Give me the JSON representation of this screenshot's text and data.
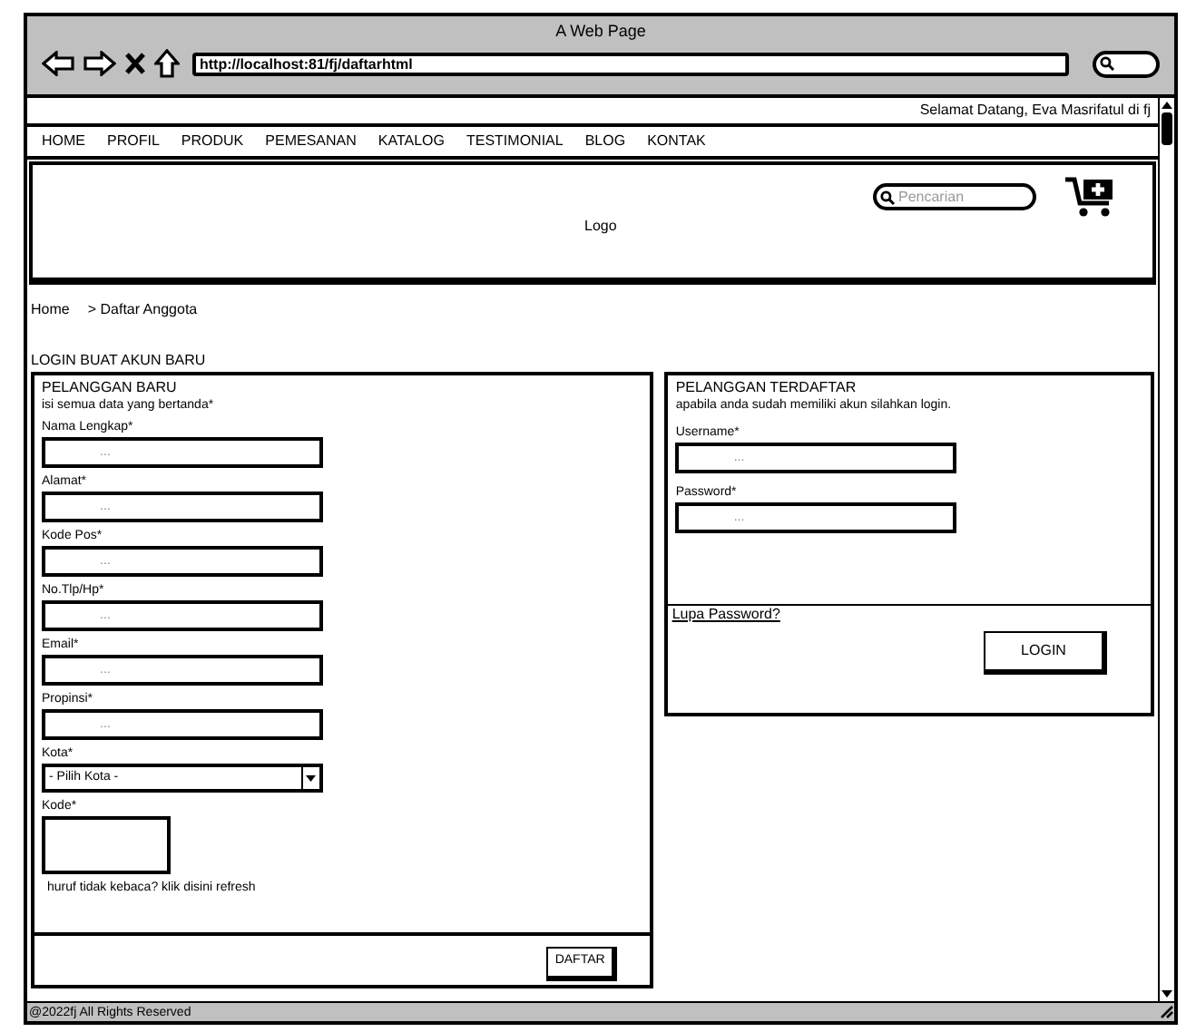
{
  "window": {
    "title": "A Web Page",
    "url": "http://localhost:81/fj/daftarhtml"
  },
  "welcome": "Selamat Datang, Eva Masrifatul di fj",
  "menu": [
    {
      "label": "HOME"
    },
    {
      "label": "PROFIL"
    },
    {
      "label": "PRODUK"
    },
    {
      "label": "PEMESANAN"
    },
    {
      "label": "KATALOG"
    },
    {
      "label": "TESTIMONIAL"
    },
    {
      "label": "BLOG"
    },
    {
      "label": "KONTAK"
    }
  ],
  "header": {
    "logo": "Logo",
    "search": {
      "placeholder": "Pencarian"
    }
  },
  "breadcrumb": [
    "Home",
    "> Daftar Anggota"
  ],
  "section_title": "LOGIN BUAT AKUN BARU",
  "new_customer": {
    "title": "PELANGGAN BARU",
    "subtitle": "isi semua data yang bertanda*",
    "fields": [
      {
        "kind": "text",
        "label": "Nama Lengkap*",
        "placeholder": "..."
      },
      {
        "kind": "text",
        "label": "Alamat*",
        "placeholder": "..."
      },
      {
        "kind": "text",
        "label": "Kode Pos*",
        "placeholder": "..."
      },
      {
        "kind": "text",
        "label": "No.Tlp/Hp*",
        "placeholder": "..."
      },
      {
        "kind": "text",
        "label": "Email*",
        "placeholder": "..."
      },
      {
        "kind": "text",
        "label": "Propinsi*",
        "placeholder": "..."
      },
      {
        "kind": "select",
        "label": "Kota*",
        "value": "- Pilih Kota -"
      },
      {
        "kind": "captcha",
        "label": "Kode*",
        "note": "huruf tidak kebaca? klik disini refresh"
      }
    ],
    "button": "DAFTAR"
  },
  "registered_customer": {
    "title": "PELANGGAN TERDAFTAR",
    "subtitle": "apabila anda sudah memiliki akun silahkan login.",
    "fields": [
      {
        "label": "Username*",
        "placeholder": "..."
      },
      {
        "label": "Password*",
        "placeholder": "..."
      }
    ],
    "forgot_link": "Lupa Password?",
    "button": "LOGIN"
  },
  "footer": "@2022fj All Rights Reserved"
}
